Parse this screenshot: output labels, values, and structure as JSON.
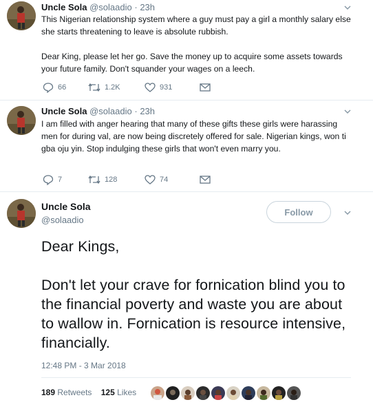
{
  "tweets": [
    {
      "name": "Uncle Sola",
      "handle": "@solaadio",
      "dot": "·",
      "time": "23h",
      "text": "This Nigerian relationship system where a guy must pay a girl a monthly salary else she starts threatening to leave is absolute rubbish.\n\nDear King, please let her go. Save the money up to acquire some assets towards your future family. Don't squander your wages on a leech.",
      "replies": "66",
      "retweets": "1.2K",
      "likes": "931"
    },
    {
      "name": "Uncle Sola",
      "handle": "@solaadio",
      "dot": "·",
      "time": "23h",
      "text": "I am filled with anger hearing that many of these gifts these girls were harassing men for during val, are now being discretely offered for sale. Nigerian kings, won ti gba oju yin. Stop indulging these girls that won't even marry you.",
      "replies": "7",
      "retweets": "128",
      "likes": "74"
    }
  ],
  "main_tweet": {
    "name": "Uncle Sola",
    "handle": "@solaadio",
    "follow_label": "Follow",
    "text_line1": "Dear Kings,",
    "text_para2": "Don't let your crave for fornication blind you to the financial poverty and waste you are about to wallow in. Fornication is resource intensive, financially.",
    "timestamp": "12:48 PM - 3 Mar 2018",
    "retweet_count": "189",
    "retweet_label": "Retweets",
    "like_count": "125",
    "like_label": "Likes"
  },
  "icons": {
    "reply": "reply-icon",
    "retweet": "retweet-icon",
    "like": "heart-icon",
    "dm": "envelope-icon",
    "more": "chevron-down-icon"
  },
  "colors": {
    "text": "#14171a",
    "secondary": "#657786",
    "border": "#e6ecf0"
  }
}
